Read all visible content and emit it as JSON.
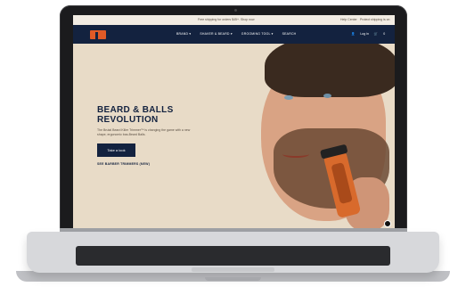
{
  "announcement": {
    "text": "Free shipping for orders $45+. Shop now",
    "help": "Help Center",
    "extra": "Protect shipping is on"
  },
  "nav": {
    "links": [
      "BRAND ▾",
      "SHAVER & BEARD ▾",
      "GROOMING TOOL ▾",
      "SEARCH"
    ],
    "login": "Log in",
    "cart": "0"
  },
  "hero": {
    "headline_line1": "BEARD & BALLS",
    "headline_line2": "REVOLUTION",
    "subtext": "The Brutal Beard Killer Trimmer™ is changing the game with a new shape, ergonomic bas-Beard Balls.",
    "cta_label": "Take a look",
    "secondary_link": "SEE BARBER TRIMMERS (NEW)"
  },
  "icons": {
    "logo": "brand-logo",
    "account": "user-icon",
    "cart": "cart-icon",
    "chat": "chat-bubble-icon"
  },
  "colors": {
    "navy": "#13223f",
    "orange": "#e05a26",
    "beige": "#e8dbc7"
  }
}
